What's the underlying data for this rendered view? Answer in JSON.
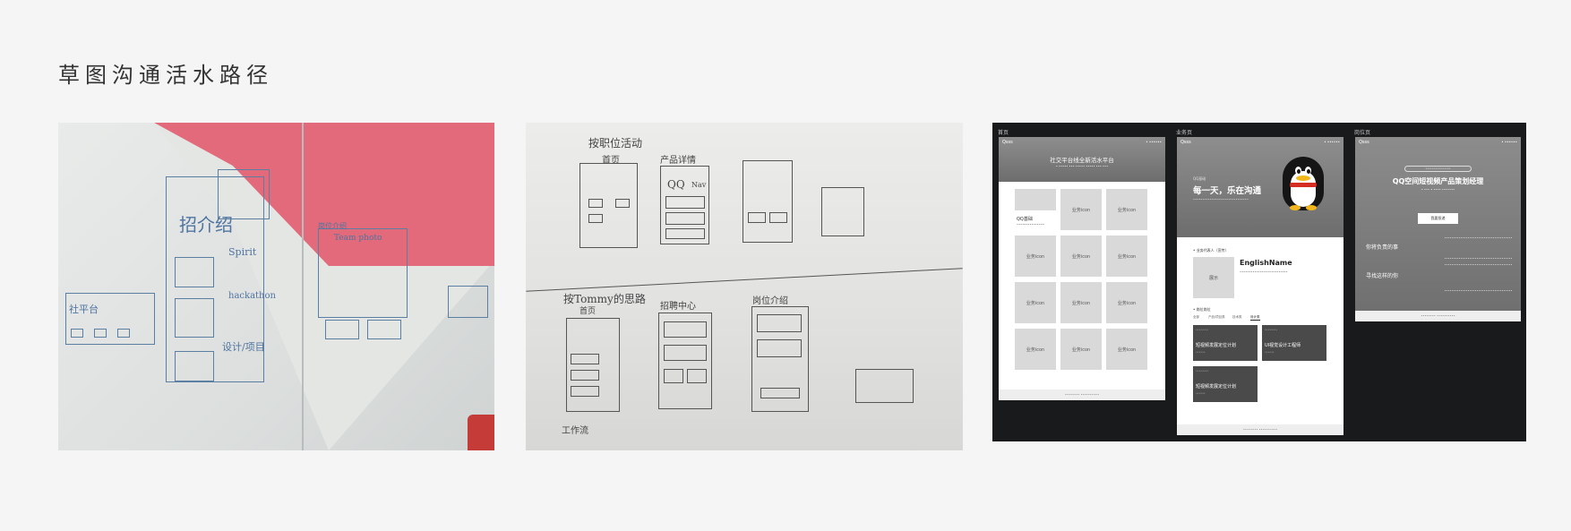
{
  "page": {
    "title": "草图沟通活水路径"
  },
  "whiteboard": {
    "texts": [
      "招介绍",
      "社平台",
      "Spirit",
      "hackathon",
      "设计/项目",
      "Team photo",
      "岗位介绍"
    ]
  },
  "sketch": {
    "texts": [
      "按职位活动",
      "首页",
      "产品详情",
      "QQ",
      "Nav",
      "按Tommy的思路",
      "首页",
      "招聘中心",
      "岗位介绍",
      "工作流"
    ]
  },
  "wireframes": {
    "screens": [
      {
        "label": "首页",
        "logo": "Qsss",
        "nav": "• ••••••",
        "hero_title": "社交平台线全新活水平台",
        "hero_sub": "• ••••• ••• ••••• ••••• ••• •••",
        "feature_title": "QQ基础",
        "feature_desc": "•••••••••••••••",
        "cell_label": "业务icon",
        "footer": "•••••••• ••••••••••"
      },
      {
        "label": "业务页",
        "logo": "Qsss",
        "nav": "• ••••••",
        "hero_kicker": "QQ基础",
        "hero_title": "每一天，乐在沟通",
        "hero_sub": "••••••••••••••••••••••••••••••",
        "section_title": "• 业务代表人（宣传）",
        "avatar_label": "展示",
        "person_name": "EnglishName",
        "person_desc": "••••••••••••••••••••••••••",
        "jobs_title": "• 岗位岗位",
        "tabs": [
          "全部",
          "产品/项目类",
          "技术类",
          "设计类"
        ],
        "jobs": [
          {
            "tag": "••••••••",
            "title": "短视频发展定位计划",
            "meta": "••••••"
          },
          {
            "tag": "••••••••",
            "title": "UI视觉设计工程师",
            "meta": "••••••"
          },
          {
            "tag": "••••••••",
            "title": "短视频发展定位计划",
            "meta": "••••••"
          }
        ],
        "footer": "•••••••• ••••••••••"
      },
      {
        "label": "岗位页",
        "logo": "Qsss",
        "nav": "• ••••••",
        "hero_kicker": "••••••••••••••••",
        "hero_title": "QQ空间短视频产品策划经理",
        "hero_meta": "• ••• • •••• •••••••",
        "apply_label": "我要投递",
        "sec1": "你将负责的事",
        "sec2": "寻找这样的你",
        "footer": "•••••••• ••••••••••"
      }
    ]
  },
  "colors": {
    "background": "#f5f5f5",
    "wall_pink": "#e26a7a",
    "wireframe_dark": "#181a1b",
    "hero_gray": "#7a7a7a",
    "job_card": "#4a4a4a"
  }
}
